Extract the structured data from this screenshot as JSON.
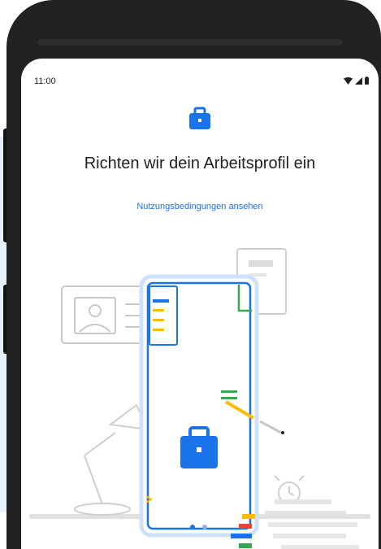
{
  "status_bar": {
    "time": "11:00",
    "icons": [
      "wifi-icon",
      "signal-icon",
      "battery-icon"
    ]
  },
  "setup": {
    "icon": "briefcase-icon",
    "title": "Richten wir dein Arbeitsprofil ein",
    "terms_link": "Nutzungsbedingungen ansehen"
  },
  "illustration": {
    "pager": {
      "pages": 2,
      "active": 1
    }
  },
  "colors": {
    "accent": "#1a73e8",
    "text": "#202124",
    "frame": "#222222",
    "red": "#ea4335",
    "yellow": "#fbbc04",
    "green": "#34a853"
  }
}
